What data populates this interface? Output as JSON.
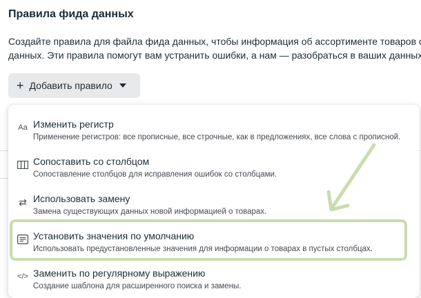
{
  "page": {
    "title": "Правила фида данных",
    "description_line1": "Создайте правила для файла фида данных, чтобы информация об ассортименте товаров со",
    "description_line2": "данных. Эти правила помогут вам устранить ошибки, а нам — разобраться в ваших данных."
  },
  "add_rule_button": {
    "label": "Добавить правило",
    "icon": "plus-icon",
    "dropdown_icon": "caret-down-icon"
  },
  "menu": {
    "items": [
      {
        "title": "Изменить регистр",
        "subtitle": "Применение регистров: все прописные, все строчные, как в предложениях, все слова с прописной.",
        "icon": "Aa",
        "icon_name": "text-case-icon"
      },
      {
        "title": "Сопоставить со столбцом",
        "subtitle": "Сопоставление столбцов для исправления ошибок со столбцами.",
        "icon": "columns",
        "icon_name": "columns-icon"
      },
      {
        "title": "Использовать замену",
        "subtitle": "Замена существующих данных новой информацией о товарах.",
        "icon": "⇄",
        "icon_name": "swap-icon"
      },
      {
        "title": "Установить значения по умолчанию",
        "subtitle": "Использовать предустановленные значения для информации о товарах в пустых столбцах.",
        "icon": "list",
        "icon_name": "default-values-icon",
        "highlighted": true
      },
      {
        "title": "Заменить по регулярному выражению",
        "subtitle": "Создание шаблона для расширенного поиска и замены.",
        "icon": "</>",
        "icon_name": "code-icon"
      }
    ]
  },
  "colors": {
    "highlight_outline": "#c9dcaf",
    "annotation_arrow": "#c9dcaf",
    "button_bg": "#e8e9eb",
    "text_primary": "#1c2b33"
  }
}
